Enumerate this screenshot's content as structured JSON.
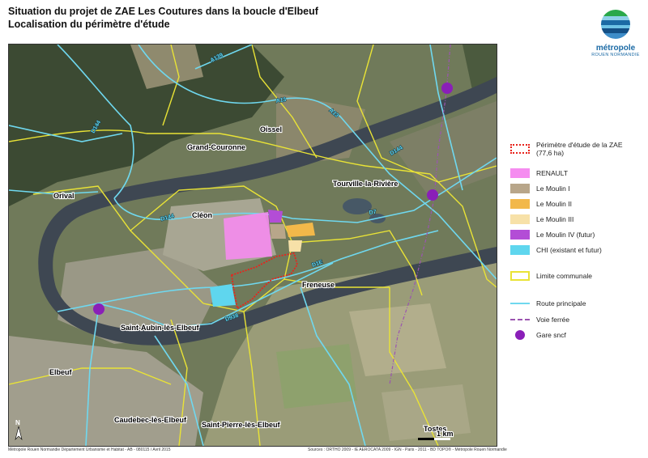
{
  "title": {
    "line1": "Situation du projet de ZAE Les Coutures dans la boucle d'Elbeuf",
    "line2": "Localisation du périmètre d'étude"
  },
  "logo": {
    "name": "métropole",
    "sub": "ROUEN NORMANDIE"
  },
  "map": {
    "places": [
      "Oissel",
      "Grand-Couronne",
      "Orival",
      "Cléon",
      "Tourville-la-Rivière",
      "Freneuse",
      "Saint-Aubin-lès-Elbeuf",
      "Elbeuf",
      "Caudebec-lès-Elbeuf",
      "Saint-Pierre-lès-Elbeuf",
      "Tostes"
    ],
    "roads": [
      "A139",
      "A13",
      "A13",
      "D144",
      "D144",
      "D7",
      "D938",
      "D144",
      "D1E"
    ],
    "north": "N",
    "scale": "1 km"
  },
  "legend": {
    "items": [
      {
        "label": "Périmètre d'étude de la ZAE (77,6 ha)",
        "kind": "dotted-red"
      },
      {
        "label": "RENAULT",
        "kind": "fill",
        "color": "#f58cf0"
      },
      {
        "label": "Le Moulin I",
        "kind": "fill",
        "color": "#b8a68a"
      },
      {
        "label": "Le Moulin II",
        "kind": "fill",
        "color": "#f2b84a"
      },
      {
        "label": "Le Moulin III",
        "kind": "fill",
        "color": "#f7e1a8"
      },
      {
        "label": "Le Moulin IV (futur)",
        "kind": "fill",
        "color": "#b34dd6"
      },
      {
        "label": "CHI (existant et futur)",
        "kind": "fill",
        "color": "#5fd6ee"
      },
      {
        "label": "Limite communale",
        "kind": "outline-yellow"
      },
      {
        "label": "Route principale",
        "kind": "line-cyan"
      },
      {
        "label": "Voie ferrée",
        "kind": "line-rail"
      },
      {
        "label": "Gare sncf",
        "kind": "dot-purple"
      }
    ]
  },
  "footer": {
    "left": "Métropole Rouen Normandie Département Urbanisme et Habitat - AB - 080115 / Avril 2015",
    "right": "Sources : ORTHO 2009 - IE AEROCATA 2009 - IGN - Paris - 2011 - BD TOPO® - Métropole Rouen Normandie"
  },
  "colors": {
    "commune": "#e9e336",
    "road": "#6fd8ef",
    "rail": "#9b55b0",
    "perimeter": "#e8241d",
    "station": "#8a1fb8",
    "river": "#3c4550"
  }
}
